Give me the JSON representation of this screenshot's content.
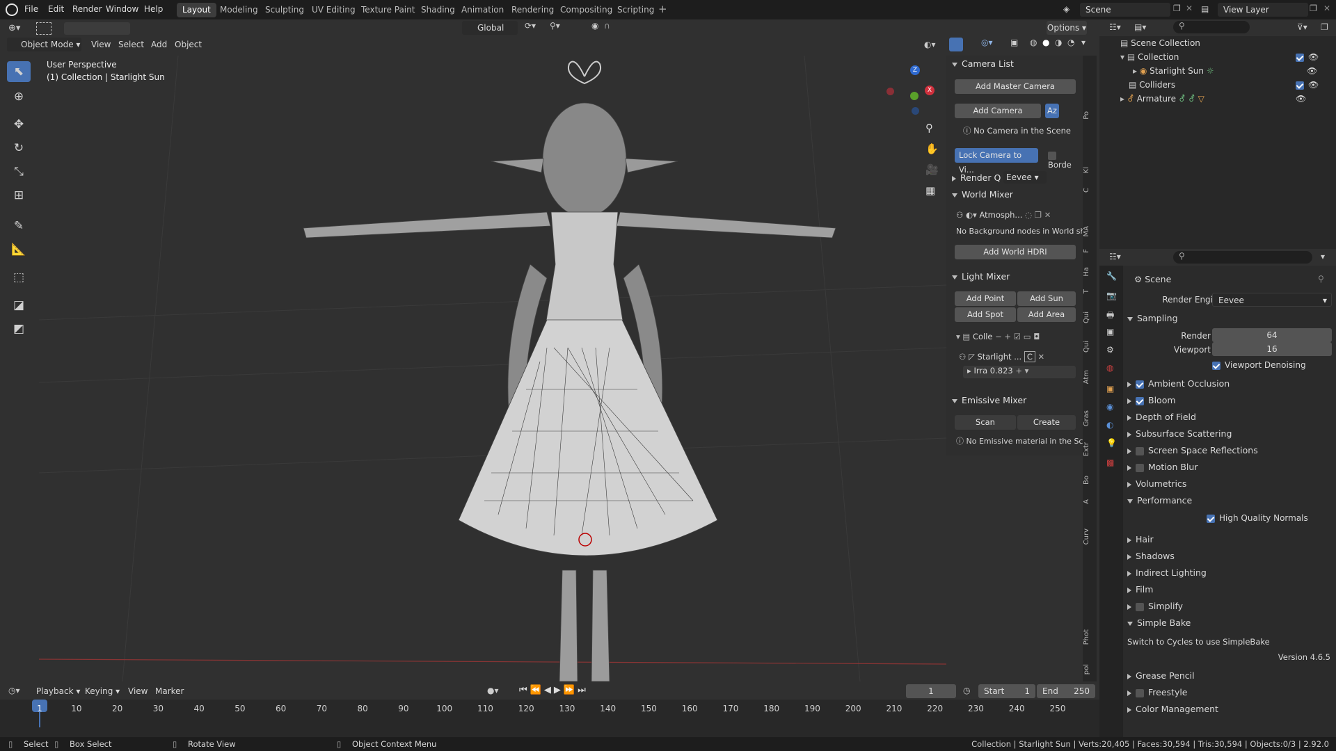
{
  "topbar": {
    "menus": [
      "File",
      "Edit",
      "Render",
      "Window",
      "Help"
    ],
    "workspaces": [
      "Layout",
      "Modeling",
      "Sculpting",
      "UV Editing",
      "Texture Paint",
      "Shading",
      "Animation",
      "Rendering",
      "Compositing",
      "Scripting"
    ],
    "active_workspace": "Layout",
    "scene_name": "Scene",
    "view_layer": "View Layer"
  },
  "viewport_header": {
    "mode": "Object Mode",
    "menus": [
      "View",
      "Select",
      "Add",
      "Object"
    ],
    "transform_orientation": "Global",
    "options_label": "Options"
  },
  "viewport": {
    "perspective_label": "User Perspective",
    "collection_label": "(1) Collection | Starlight Sun"
  },
  "sidepanel": {
    "camera_list": {
      "title": "Camera List",
      "add_master": "Add Master Camera",
      "add_camera": "Add Camera",
      "sort_label": "Az",
      "no_camera": "No Camera in the Scene",
      "lock_camera": "Lock Camera to Vi...",
      "border": "Borde"
    },
    "render_q": {
      "label": "Render Q",
      "engine": "Eevee"
    },
    "world_mixer": {
      "title": "World Mixer",
      "world_name": "Atmosph...",
      "no_bg": "No Background nodes in World sh...",
      "add_hdri": "Add World HDRI"
    },
    "light_mixer": {
      "title": "Light Mixer",
      "add_point": "Add Point",
      "add_sun": "Add Sun",
      "add_spot": "Add Spot",
      "add_area": "Add Area",
      "collection": "Colle",
      "light_name": "Starlight ...",
      "light_c": "C",
      "irra_label": "Irra",
      "irra_value": "0.823"
    },
    "emissive_mixer": {
      "title": "Emissive Mixer",
      "scan": "Scan",
      "create": "Create",
      "no_emissive": "No Emissive material in the Sc..."
    },
    "tabs": [
      "Po",
      "Kl",
      "C",
      "MA",
      "F",
      "Ha",
      "T",
      "Qui",
      "Qui",
      "Atm",
      "Gras",
      "Extr",
      "Bo",
      "A",
      "Curv",
      "Phot",
      "pol"
    ]
  },
  "outliner": {
    "items": [
      {
        "label": "Scene Collection",
        "level": 0
      },
      {
        "label": "Collection",
        "level": 1
      },
      {
        "label": "Starlight Sun",
        "level": 2
      },
      {
        "label": "Colliders",
        "level": 1
      },
      {
        "label": "Armature",
        "level": 1
      }
    ]
  },
  "properties": {
    "context": "Scene",
    "render_engine_label": "Render Engine",
    "render_engine": "Eevee",
    "sampling_title": "Sampling",
    "render_label": "Render",
    "render_samples": "64",
    "viewport_label": "Viewport",
    "viewport_samples": "16",
    "viewport_denoising": "Viewport Denoising",
    "sections": [
      {
        "label": "Ambient Occlusion",
        "checkbox": true,
        "checked": true
      },
      {
        "label": "Bloom",
        "checkbox": true,
        "checked": true
      },
      {
        "label": "Depth of Field",
        "checkbox": false
      },
      {
        "label": "Subsurface Scattering",
        "checkbox": false
      },
      {
        "label": "Screen Space Reflections",
        "checkbox": true,
        "checked": false
      },
      {
        "label": "Motion Blur",
        "checkbox": true,
        "checked": false
      },
      {
        "label": "Volumetrics",
        "checkbox": false
      }
    ],
    "performance_title": "Performance",
    "high_quality_normals": "High Quality Normals",
    "sections2": [
      {
        "label": "Hair",
        "checkbox": false
      },
      {
        "label": "Shadows",
        "checkbox": false
      },
      {
        "label": "Indirect Lighting",
        "checkbox": false
      },
      {
        "label": "Film",
        "checkbox": false
      },
      {
        "label": "Simplify",
        "checkbox": true,
        "checked": false
      }
    ],
    "simple_bake_title": "Simple Bake",
    "simple_bake_text": "Switch to Cycles to use SimpleBake",
    "version": "Version 4.6.5",
    "sections3": [
      {
        "label": "Grease Pencil",
        "checkbox": false
      },
      {
        "label": "Freestyle",
        "checkbox": true,
        "checked": false
      },
      {
        "label": "Color Management",
        "checkbox": false
      }
    ]
  },
  "timeline": {
    "menus": [
      "Playback",
      "Keying",
      "View",
      "Marker"
    ],
    "current_frame": "1",
    "start_label": "Start",
    "start": "1",
    "end_label": "End",
    "end": "250",
    "ticks": [
      "1",
      "10",
      "20",
      "30",
      "40",
      "50",
      "60",
      "70",
      "80",
      "90",
      "100",
      "110",
      "120",
      "130",
      "140",
      "150",
      "160",
      "170",
      "180",
      "190",
      "200",
      "210",
      "220",
      "230",
      "240",
      "250"
    ]
  },
  "statusbar": {
    "select": "Select",
    "box_select": "Box Select",
    "rotate_view": "Rotate View",
    "context_menu": "Object Context Menu",
    "stats": "Collection | Starlight Sun | Verts:20,405 | Faces:30,594 | Tris:30,594 | Objects:0/3 | 2.92.0"
  },
  "colors": {
    "accent": "#4772b3",
    "bg": "#303030",
    "panel": "#2b2b2b"
  }
}
